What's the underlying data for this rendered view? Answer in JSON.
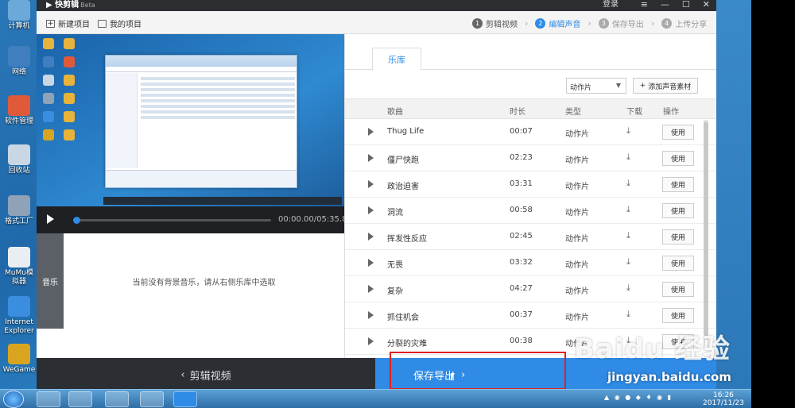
{
  "desktop": {
    "icons": [
      {
        "label": "计算机",
        "icon": "computer-icon",
        "color": "#6aa9d8"
      },
      {
        "label": "网络",
        "icon": "network-icon",
        "color": "#3f7fc0"
      },
      {
        "label": "软件管理",
        "icon": "software-manager-icon",
        "color": "#e05a3a"
      },
      {
        "label": "回收站",
        "icon": "recycle-bin-icon",
        "color": "#c9d6e3"
      },
      {
        "label": "格式工厂",
        "icon": "format-factory-icon",
        "color": "#8fa2b8"
      },
      {
        "label": "MuMu模拟器",
        "icon": "mumu-emulator-icon",
        "color": "#e9eef3"
      },
      {
        "label": "Internet Explorer",
        "icon": "ie-icon",
        "color": "#3b8de0"
      },
      {
        "label": "WeGame",
        "icon": "wegame-icon",
        "color": "#d9a521"
      }
    ]
  },
  "app": {
    "title": "快剪辑",
    "beta": "Beta",
    "login": "登录",
    "window_controls": [
      "≡",
      "—",
      "☐",
      "✕"
    ],
    "toolbar": {
      "new_project": "新建项目",
      "my_projects": "我的项目"
    },
    "steps": [
      {
        "num": "1",
        "label": "剪辑视频",
        "state": "done"
      },
      {
        "num": "2",
        "label": "编辑声音",
        "state": "active"
      },
      {
        "num": "3",
        "label": "保存导出",
        "state": "pending"
      },
      {
        "num": "4",
        "label": "上传分享",
        "state": "pending"
      }
    ],
    "player": {
      "timecode": "00:00.00/05:35.80"
    },
    "music": {
      "label": "音乐",
      "empty_text": "当前没有背景音乐，请从右侧乐库中选取"
    },
    "library": {
      "tab": "乐库",
      "category_select": "动作片",
      "add_button": "添加声音素材",
      "columns": [
        "歌曲",
        "时长",
        "类型",
        "下载",
        "操作"
      ],
      "rows": [
        {
          "name": "Thug Life",
          "duration": "00:07",
          "type": "动作片"
        },
        {
          "name": "僵尸快跑",
          "duration": "02:23",
          "type": "动作片"
        },
        {
          "name": "政治迫害",
          "duration": "03:31",
          "type": "动作片"
        },
        {
          "name": "洞流",
          "duration": "00:58",
          "type": "动作片"
        },
        {
          "name": "挥发性反应",
          "duration": "02:45",
          "type": "动作片"
        },
        {
          "name": "无畏",
          "duration": "03:32",
          "type": "动作片"
        },
        {
          "name": "复杂",
          "duration": "04:27",
          "type": "动作片"
        },
        {
          "name": "抓住机会",
          "duration": "00:37",
          "type": "动作片"
        },
        {
          "name": "分裂的灾难",
          "duration": "00:38",
          "type": "动作片"
        }
      ],
      "use_label": "使用"
    },
    "footer": {
      "back": "剪辑视频",
      "next": "保存导出"
    }
  },
  "taskbar": {
    "time": "16:26",
    "date": "2017/11/23"
  },
  "watermark": {
    "brand": "Baidu 经验",
    "url": "jingyan.baidu.com"
  },
  "colors": {
    "accent": "#2f8be6",
    "highlight": "#e02020"
  }
}
